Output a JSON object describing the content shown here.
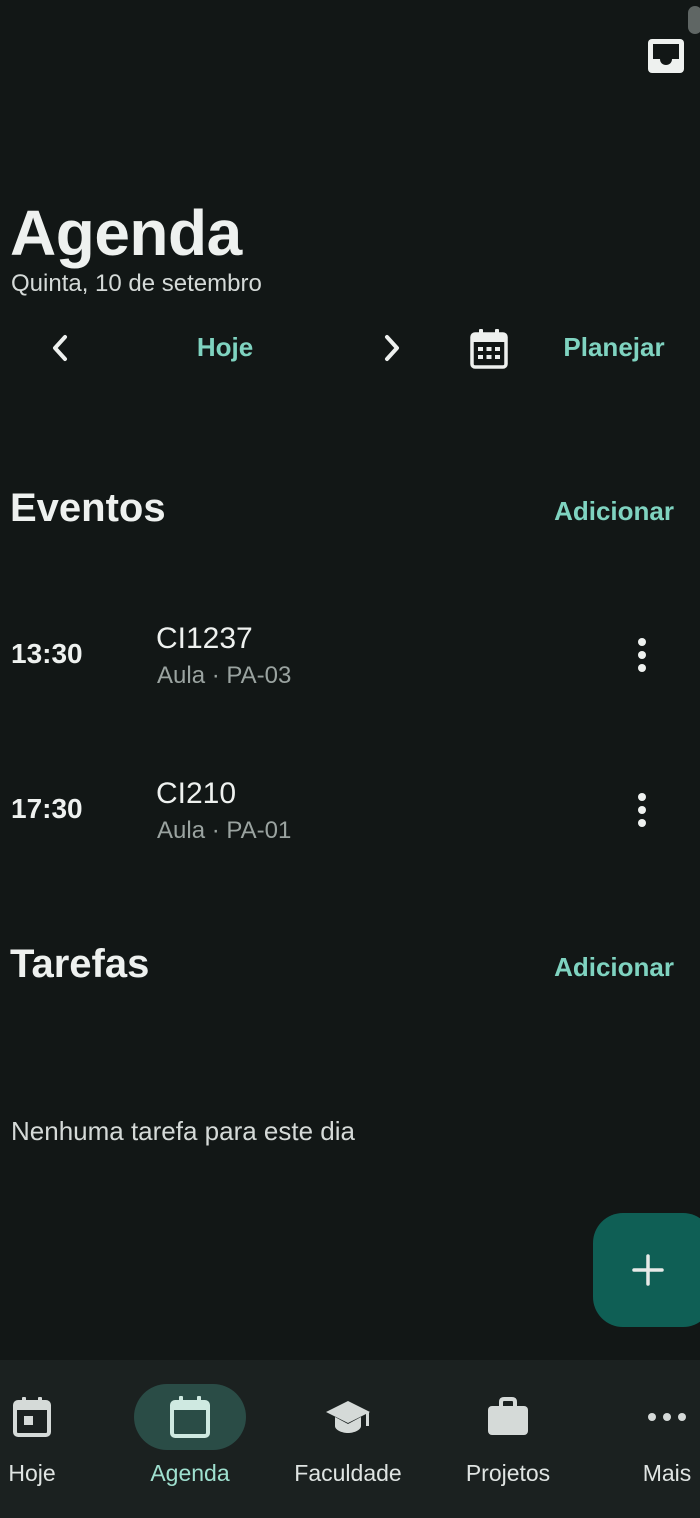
{
  "header": {
    "title": "Agenda",
    "date": "Quinta, 10 de setembro"
  },
  "day_nav": {
    "today_label": "Hoje",
    "plan_label": "Planejar"
  },
  "events": {
    "title": "Eventos",
    "add_label": "Adicionar",
    "items": [
      {
        "time": "13:30",
        "title": "CI1237",
        "subtitle": "Aula · PA-03"
      },
      {
        "time": "17:30",
        "title": "CI210",
        "subtitle": "Aula · PA-01"
      }
    ]
  },
  "tasks": {
    "title": "Tarefas",
    "add_label": "Adicionar",
    "empty_text": "Nenhuma tarefa para este dia"
  },
  "bottom_nav": {
    "items": [
      {
        "label": "Hoje",
        "icon": "calendar-day-icon"
      },
      {
        "label": "Agenda",
        "icon": "calendar-icon",
        "active": true
      },
      {
        "label": "Faculdade",
        "icon": "graduation-cap-icon"
      },
      {
        "label": "Projetos",
        "icon": "briefcase-icon"
      },
      {
        "label": "Mais",
        "icon": "more-horizontal-icon"
      }
    ]
  },
  "colors": {
    "background": "#121716",
    "accent": "#7fd3c0",
    "fab": "#0f5f55",
    "nav_bar": "#1b2120",
    "nav_active_pill": "#2a4c46"
  }
}
